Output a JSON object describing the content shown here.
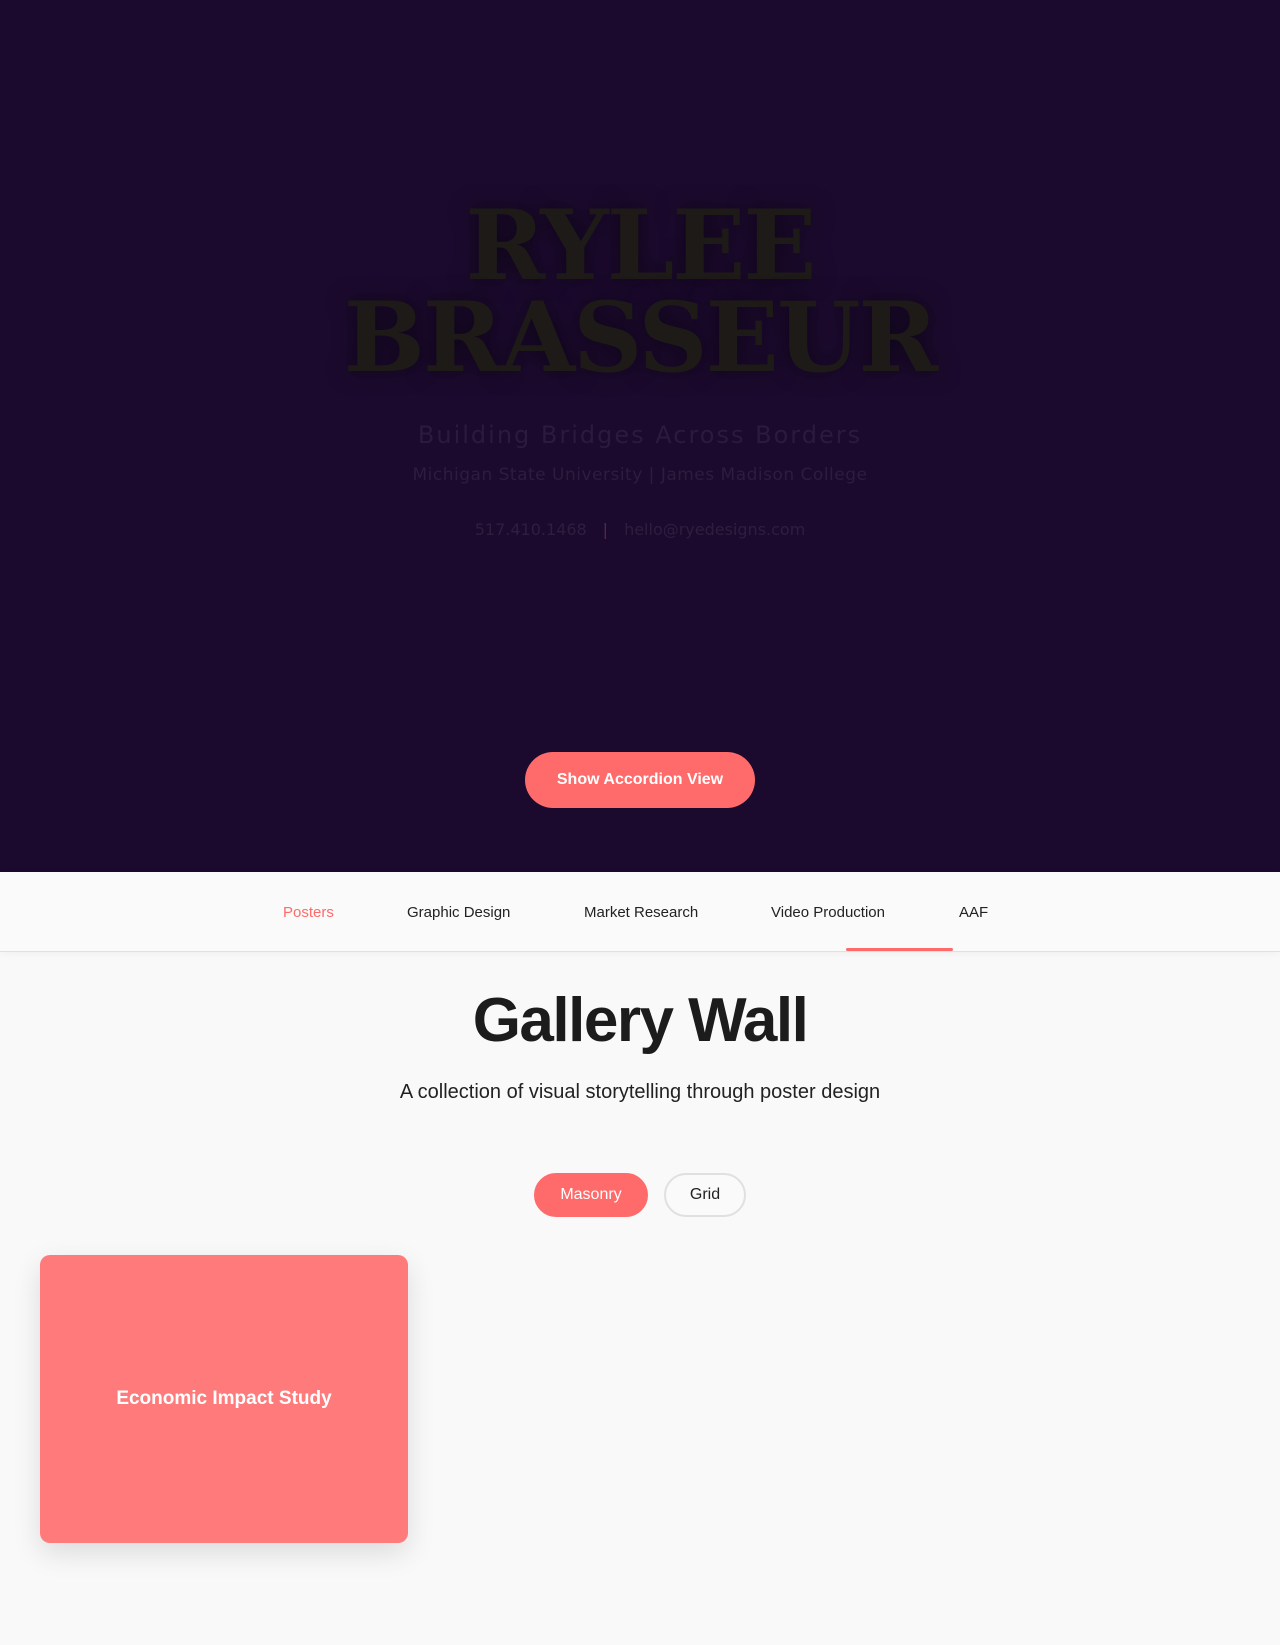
{
  "hero": {
    "name_line1": "RYLEE",
    "name_line2": "BRASSEUR",
    "tagline": "Building Bridges Across Borders",
    "school": "Michigan State University | James Madison College",
    "phone": "517.410.1468",
    "separator": "|",
    "email": "hello@ryedesigns.com",
    "accordion_button": "Show Accordion View"
  },
  "nav": {
    "items": [
      {
        "label": "Posters",
        "active": true
      },
      {
        "label": "Graphic Design",
        "active": false
      },
      {
        "label": "Market Research",
        "active": false
      },
      {
        "label": "Video Production",
        "active": false
      },
      {
        "label": "AAF",
        "active": false
      }
    ]
  },
  "gallery": {
    "title": "Gallery Wall",
    "subtitle": "A collection of visual storytelling through poster design",
    "view_options": [
      {
        "label": "Masonry",
        "selected": true
      },
      {
        "label": "Grid",
        "selected": false
      }
    ],
    "posters": [
      {
        "title": "Economic Impact Study"
      }
    ]
  },
  "colors": {
    "hero_background": "#1c0a2e",
    "accent": "#ff6b6b",
    "poster_card": "#ff7b7b",
    "page_background": "#f9f9f9"
  }
}
